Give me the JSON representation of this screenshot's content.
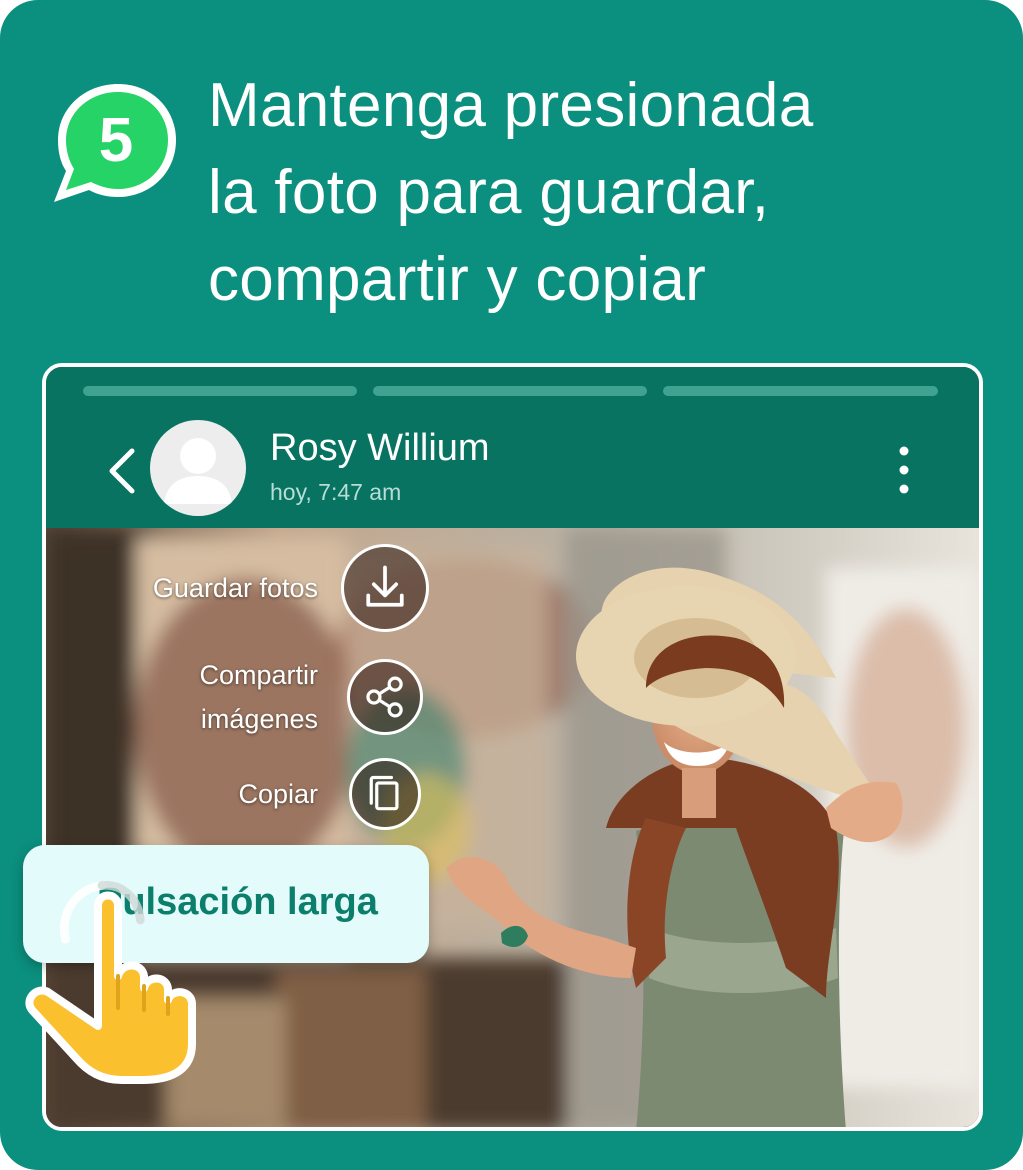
{
  "step": {
    "number": "5"
  },
  "headline": {
    "lines": [
      "Mantenga presionada",
      "la foto para guardar,",
      "compartir y copiar"
    ]
  },
  "chat": {
    "contact_name": "Rosy Willium",
    "timestamp": "hoy, 7:47 am"
  },
  "actions": {
    "save": {
      "label": "Guardar fotos",
      "icon": "download-icon"
    },
    "share": {
      "label_line1": "Compartir",
      "label_line2": "imágenes",
      "icon": "share-icon"
    },
    "copy": {
      "label": "Copiar",
      "icon": "copy-icon"
    }
  },
  "hint": {
    "label": "Pulsación larga"
  },
  "colors": {
    "background": "#0b8f7e",
    "header": "#077360",
    "badge": "#25d366",
    "hint_text": "#0b7f6c",
    "hand": "#fbc02d"
  }
}
